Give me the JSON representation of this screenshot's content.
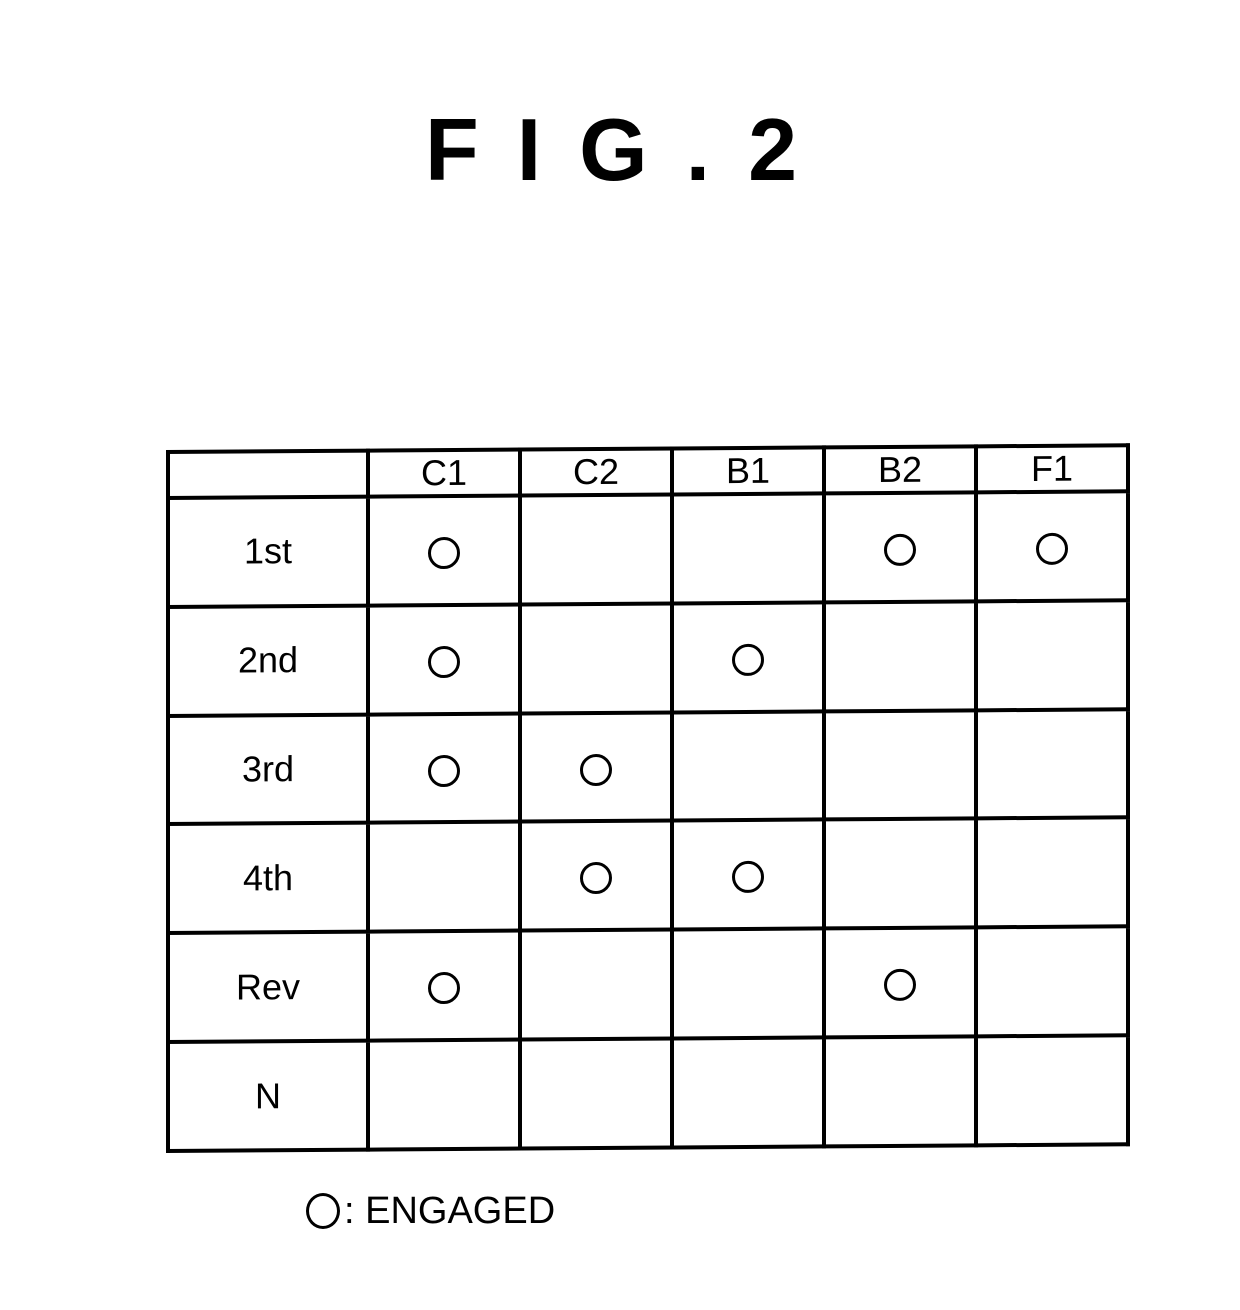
{
  "figure": {
    "title": "FIG.2"
  },
  "table": {
    "corner_label": "",
    "columns": [
      "C1",
      "C2",
      "B1",
      "B2",
      "F1"
    ],
    "rows": [
      {
        "label": "1st",
        "engaged": [
          true,
          false,
          false,
          true,
          true
        ]
      },
      {
        "label": "2nd",
        "engaged": [
          true,
          false,
          true,
          false,
          false
        ]
      },
      {
        "label": "3rd",
        "engaged": [
          true,
          true,
          false,
          false,
          false
        ]
      },
      {
        "label": "4th",
        "engaged": [
          false,
          true,
          true,
          false,
          false
        ]
      },
      {
        "label": "Rev",
        "engaged": [
          true,
          false,
          false,
          true,
          false
        ]
      },
      {
        "label": "N",
        "engaged": [
          false,
          false,
          false,
          false,
          false
        ]
      }
    ],
    "engaged_symbol": "circle-icon"
  },
  "legend": {
    "symbol": "circle-icon",
    "text": ": ENGAGED"
  }
}
